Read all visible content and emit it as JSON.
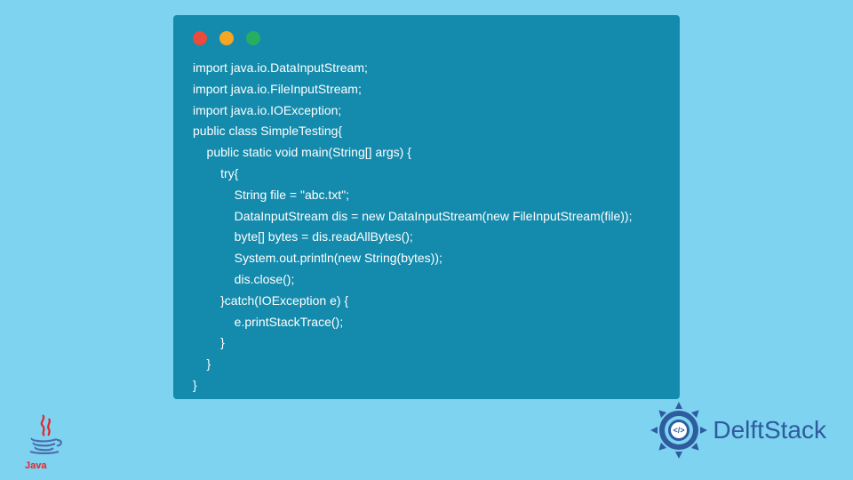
{
  "code": {
    "lines": [
      "import java.io.DataInputStream;",
      "import java.io.FileInputStream;",
      "import java.io.IOException;",
      "public class SimpleTesting{",
      "    public static void main(String[] args) {",
      "        try{",
      "            String file = \"abc.txt\";",
      "            DataInputStream dis = new DataInputStream(new FileInputStream(file));",
      "            byte[] bytes = dis.readAllBytes();",
      "            System.out.println(new String(bytes));",
      "            dis.close();",
      "        }catch(IOException e) {",
      "            e.printStackTrace();",
      "        }",
      "    }",
      "}"
    ]
  },
  "logos": {
    "java_label": "Java",
    "delft_label": "DelftStack"
  },
  "colors": {
    "page_bg": "#7DD3F0",
    "window_bg": "#148BAD",
    "dot_red": "#E94B3C",
    "dot_yellow": "#F5A623",
    "dot_green": "#27AE60",
    "code_text": "#FFFFFF",
    "java_red": "#E8222A",
    "java_blue": "#4B6EAF",
    "delft_blue": "#2E5C9E"
  }
}
